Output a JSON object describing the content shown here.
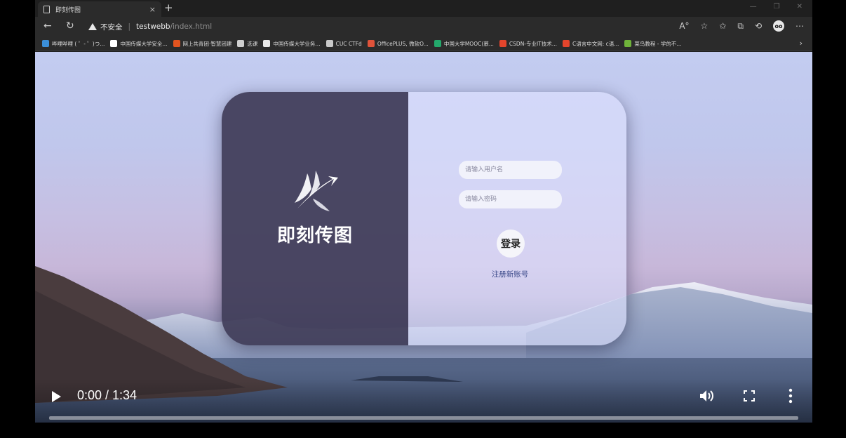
{
  "browser": {
    "tab_title": "即刻传图",
    "tab_close": "×",
    "new_tab": "+",
    "win_min": "—",
    "win_restore": "❐",
    "win_close": "✕",
    "security_label": "不安全",
    "url_host": "testwebb",
    "url_path": "/index.html",
    "profile_initials": "oo"
  },
  "bookmarks": [
    {
      "label": "哔哩哔哩 ( ゜- ゜)つ...",
      "color": "#3b8fd9"
    },
    {
      "label": "中国传媒大学安全...",
      "color": "#ffffff"
    },
    {
      "label": "网上共青团·智慧团建",
      "color": "#e2541f"
    },
    {
      "label": "选课",
      "color": "#cfcfcf"
    },
    {
      "label": "中国传媒大学业务...",
      "color": "#e8e8e8"
    },
    {
      "label": "CUC CTFd",
      "color": "#c9c9c9"
    },
    {
      "label": "OfficePLUS, 微软O...",
      "color": "#e0533a"
    },
    {
      "label": "中国大学MOOC(慕...",
      "color": "#23a86b"
    },
    {
      "label": "CSDN-专业IT技术...",
      "color": "#e3452c"
    },
    {
      "label": "C语言中文网: c语...",
      "color": "#e3452c"
    },
    {
      "label": "菜鸟教程 - 学的不...",
      "color": "#6fb33a"
    }
  ],
  "login": {
    "brand_name": "即刻传图",
    "username_placeholder": "请输入用户名",
    "password_placeholder": "请输入密码",
    "login_label": "登录",
    "register_label": "注册新账号"
  },
  "video": {
    "time": "0:00 / 1:34",
    "progress": 0.0
  }
}
